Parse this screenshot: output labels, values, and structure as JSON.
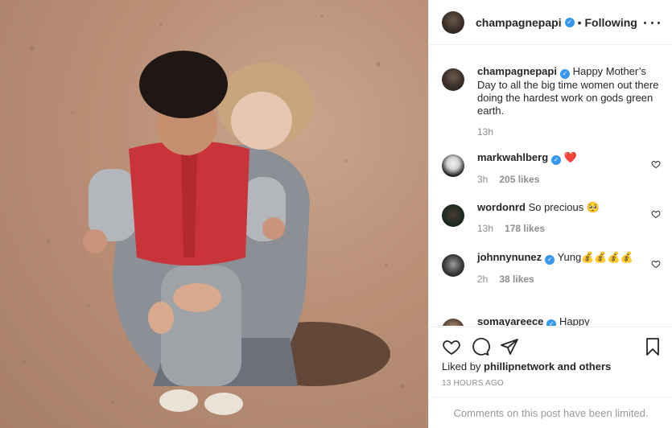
{
  "header": {
    "username": "champagnepapi",
    "separator": "•",
    "follow_status": "Following"
  },
  "caption": {
    "username": "champagnepapi",
    "text": "Happy Mother’s Day to all the big time women out there doing the hardest work on gods green earth.",
    "time": "13h"
  },
  "comments": [
    {
      "username": "markwahlberg",
      "verified": true,
      "text": "❤️",
      "time": "3h",
      "likes": "205 likes"
    },
    {
      "username": "wordonrd",
      "verified": false,
      "text": "So precious 🥺",
      "time": "13h",
      "likes": "178 likes"
    },
    {
      "username": "johnnynunez",
      "verified": true,
      "text": "Yung💰💰💰💰",
      "time": "2h",
      "likes": "38 likes"
    },
    {
      "username": "somayareece",
      "verified": true,
      "text": "Happy",
      "time": "",
      "likes": ""
    }
  ],
  "footer": {
    "liked_by_prefix": "Liked by",
    "liked_by_user": "phillipnetwork",
    "liked_by_suffix": "and others",
    "timestamp": "13 HOURS AGO",
    "comments_limited": "Comments on this post have been limited."
  },
  "icons": {
    "verified": "verified-badge-icon",
    "more": "more-options-icon",
    "like": "heart-icon",
    "comment": "comment-icon",
    "share": "share-icon",
    "save": "bookmark-icon"
  },
  "colors": {
    "verified": "#3897f0",
    "heart": "#ed4956",
    "muted": "#8e8e8e"
  }
}
